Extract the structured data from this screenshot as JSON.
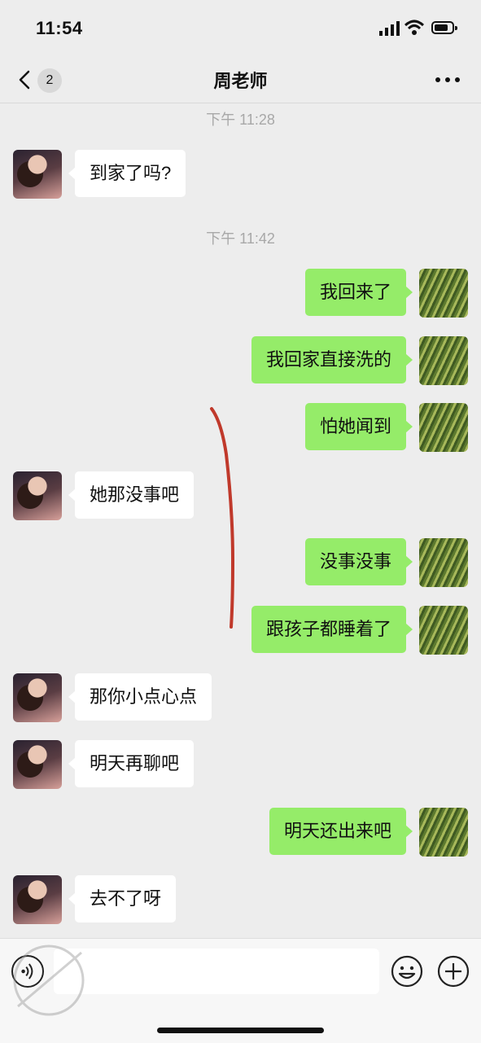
{
  "status_bar": {
    "time": "11:54",
    "icons": [
      "cellular-signal-icon",
      "wifi-icon",
      "battery-icon"
    ],
    "battery_level": 0.8
  },
  "nav": {
    "unread_count": "2",
    "title": "周老师",
    "back_icon": "chevron-left-icon",
    "more_icon": "ellipsis-icon"
  },
  "timestamps": [
    "下午 11:28",
    "下午 11:42"
  ],
  "messages": [
    {
      "side": "left",
      "text": "到家了吗?"
    },
    {
      "side": "right",
      "text": "我回来了"
    },
    {
      "side": "right",
      "text": "我回家直接洗的"
    },
    {
      "side": "right",
      "text": "怕她闻到"
    },
    {
      "side": "left",
      "text": "她那没事吧"
    },
    {
      "side": "right",
      "text": "没事没事"
    },
    {
      "side": "right",
      "text": "跟孩子都睡着了"
    },
    {
      "side": "left",
      "text": "那你小点心点"
    },
    {
      "side": "left",
      "text": "明天再聊吧"
    },
    {
      "side": "right",
      "text": "明天还出来吧"
    },
    {
      "side": "left",
      "text": "去不了呀"
    }
  ],
  "input_bar": {
    "value": "",
    "icons": [
      "voice-icon",
      "emoji-icon",
      "plus-icon"
    ]
  },
  "colors": {
    "background": "#ededed",
    "sent_bubble": "#95ec69",
    "received_bubble": "#ffffff",
    "timestamp_text": "#a8a8a8",
    "annotation_stroke": "#c0392b"
  }
}
